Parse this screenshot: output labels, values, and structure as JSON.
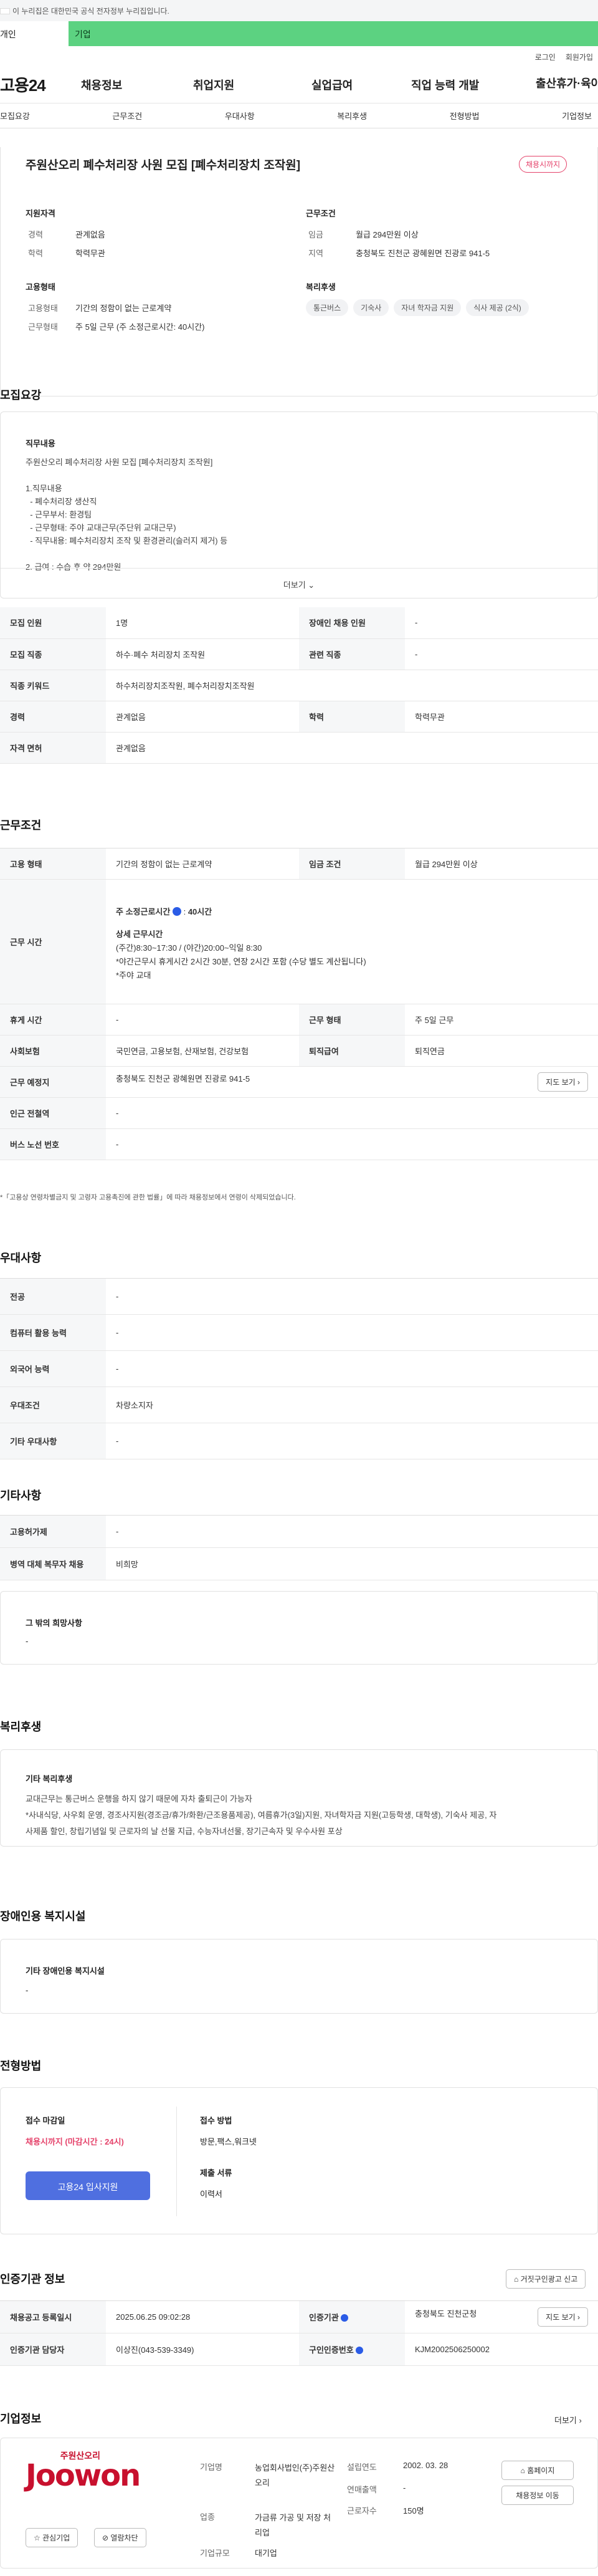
{
  "gov_banner": "이 누리집은 대한민국 공식 전자정부 누리집입니다.",
  "top_tabs": [
    "개인",
    "기업"
  ],
  "util": [
    "로그인",
    "회원가입"
  ],
  "logo": "고용24",
  "gnb": [
    "채용정보",
    "취업지원",
    "실업급여",
    "직업 능력 개발",
    "출산휴가·육아휴직"
  ],
  "lnb": [
    "모집요강",
    "근무조건",
    "우대사항",
    "복리후생",
    "전형방법",
    "기업정보"
  ],
  "job": {
    "title": "주원산오리 폐수처리장 사원 모집 [폐수처리장치 조작원]",
    "badge": "채용시까지",
    "qual_title": "지원자격",
    "career_l": "경력",
    "career_v": "관계없음",
    "edu_l": "학력",
    "edu_v": "학력무관",
    "cond_title": "근무조건",
    "wage_l": "임금",
    "wage_v": "월급 294만원 이상",
    "region_l": "지역",
    "region_v": "충청북도 진천군 광혜원면 진광로 941-5",
    "emp_title": "고용형태",
    "emptype_l": "고용형태",
    "emptype_v": "기간의 정함이 없는 근로계약",
    "worktype_l": "근무형태",
    "worktype_v": "주 5일 근무 (주 소정근로시간: 40시간)",
    "welfare_title": "복리후생",
    "welfare_chips": [
      "통근버스",
      "기숙사",
      "자녀 학자금 지원",
      "식사 제공 (2식)"
    ]
  },
  "recruit": {
    "title": "모집요강",
    "content_title": "직무내용",
    "lines": [
      "주원산오리 폐수처리장 사원 모집 [폐수처리장치 조작원]",
      "",
      "1.직무내용",
      "  - 폐수처리장 생산직",
      "  - 근무부서: 환경팀",
      "  - 근무형태: 주야 교대근무(주단위 교대근무)",
      "  - 직무내용: 폐수처리장치 조작 및 환경관리(슬러지 제거) 등",
      "",
      "2. 급여 : 수습 후 약 294만원"
    ],
    "more": "더보기",
    "rows": [
      [
        "모집 인원",
        "1명",
        "장애인 채용 인원",
        "-"
      ],
      [
        "모집 직종",
        "하수·폐수 처리장치 조작원",
        "관련 직종",
        "-"
      ],
      [
        "직종 키워드",
        "하수처리장치조작원, 폐수처리장치조작원",
        "",
        ""
      ],
      [
        "경력",
        "관계없음",
        "학력",
        "학력무관"
      ],
      [
        "자격 면허",
        "관계없음",
        "",
        ""
      ]
    ]
  },
  "conditions": {
    "title": "근무조건",
    "emp_l": "고용 형태",
    "emp_v": "기간의 정함이 없는 근로계약",
    "wage_l": "임금 조건",
    "wage_v": "월급 294만원 이상",
    "time_l": "근무 시간",
    "weekly": "주 소정근로시간",
    "weekly_v": "40시간",
    "detail_t": "상세 근무시간",
    "detail": [
      "(주간)8:30~17:30 / (야간)20:00~익일 8:30",
      "*야간근무시 휴게시간 2시간 30분, 연장 2시간 포함 (수당 별도 계산됩니다)",
      "*주야 교대"
    ],
    "rest_l": "휴게 시간",
    "rest_v": "-",
    "form_l": "근무 형태",
    "form_v": "주 5일 근무",
    "ins_l": "사회보험",
    "ins_v": "국민연금, 고용보험, 산재보험, 건강보험",
    "ret_l": "퇴직급여",
    "ret_v": "퇴직연금",
    "addr_l": "근무 예정지",
    "addr_v": "충청북도 진천군 광혜원면 진광로 941-5",
    "map": "지도 보기",
    "sub_l": "인근 전철역",
    "sub_v": "-",
    "bus_l": "버스 노선 번호",
    "bus_v": "-",
    "note": "*「고용상 연령차별금지 및 고령자 고용촉진에 관한 법률」에 따라 채용정보에서 연령이 삭제되었습니다."
  },
  "pref": {
    "title": "우대사항",
    "rows": [
      [
        "전공",
        "-"
      ],
      [
        "컴퓨터 활용 능력",
        "-"
      ],
      [
        "외국어 능력",
        "-"
      ],
      [
        "우대조건",
        "차량소지자"
      ],
      [
        "기타 우대사항",
        "-"
      ]
    ]
  },
  "etc": {
    "title": "기타사항",
    "rows": [
      [
        "고용허가제",
        "-"
      ],
      [
        "병역 대체 복무자 채용",
        "비희망"
      ]
    ],
    "other_t": "그 밖의 희망사항",
    "other_v": "-"
  },
  "welfare": {
    "title": "복리후생",
    "sub": "기타 복리후생",
    "text": [
      "교대근무는 통근버스 운행을 하지 않기 때문에 자차 출퇴근이 가능자",
      "*사내식당, 사우회 운영, 경조사지원(경조금/휴가/화환/근조용품제공), 여름휴가(3일)지원, 자녀학자금 지원(고등학생, 대학생), 기숙사 제공, 자",
      "사제품 할인, 창립기념일 및 근로자의 날 선물 지급, 수능자녀선물, 장기근속자 및 우수사원 포상"
    ]
  },
  "disabled": {
    "title": "장애인용 복지시설",
    "sub": "기타 장애인용 복지시설",
    "val": "-"
  },
  "selection": {
    "title": "전형방법",
    "deadline_l": "접수 마감일",
    "deadline_v": "채용시까지 (마감시간 : 24시)",
    "apply_btn": "고용24 입사지원",
    "method_l": "접수 방법",
    "method_v": "방문,팩스,워크넷",
    "docs_l": "제출 서류",
    "docs_v": "이력서"
  },
  "cert": {
    "title": "인증기관 정보",
    "report_btn": "거짓구인광고 신고",
    "rows": [
      [
        "채용공고 등록일시",
        "2025.06.25 09:02:28",
        "인증기관",
        "충청북도 진천군청"
      ],
      [
        "인증기관 담당자",
        "이상진(043-539-3349)",
        "구인인증번호",
        "KJM2002506250002"
      ]
    ],
    "map": "지도 보기"
  },
  "company": {
    "title": "기업정보",
    "more": "더보기",
    "logo_small": "주원산오리",
    "logo_big": "Joowon",
    "fav": "관심기업",
    "block": "열람차단",
    "ind_l": "기업명",
    "ind_v": "농업회사법인(주)주원산오리",
    "biz_l": "업종",
    "biz_v": "가금류 가공 및 저장 처리업",
    "size_l": "기업규모",
    "size_v": "대기업",
    "est_l": "설립연도",
    "est_v": "2002. 03. 28",
    "sales_l": "연매출액",
    "sales_v": "-",
    "emp_l": "근로자수",
    "emp_v": "150명",
    "home": "홈페이지",
    "jobs": "채용정보 이동"
  }
}
